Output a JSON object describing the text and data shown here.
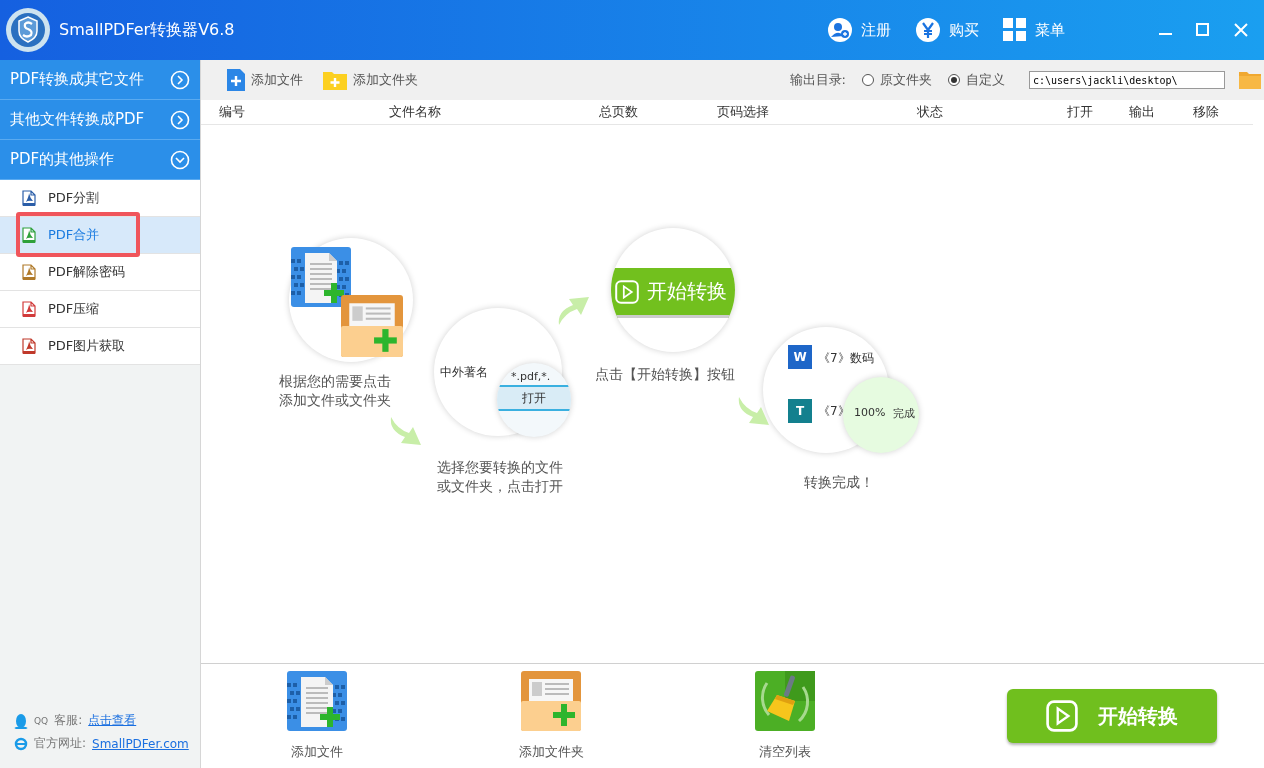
{
  "window": {
    "title": "SmallPDFer转换器V6.8",
    "actions": [
      {
        "kind": "register",
        "label": "注册"
      },
      {
        "kind": "buy",
        "label": "购买"
      },
      {
        "kind": "menu",
        "label": "菜单"
      }
    ]
  },
  "sidebar": {
    "sections": [
      {
        "label": "PDF转换成其它文件",
        "expanded": false
      },
      {
        "label": "其他文件转换成PDF",
        "expanded": false
      },
      {
        "label": "PDF的其他操作",
        "expanded": true,
        "items": [
          {
            "label": "PDF分割",
            "color": "#2b5ea8",
            "selected": false,
            "highlighted": false
          },
          {
            "label": "PDF合并",
            "color": "#2ea13a",
            "selected": true,
            "highlighted": true
          },
          {
            "label": "PDF解除密码",
            "color": "#b07a2a",
            "selected": false,
            "highlighted": false
          },
          {
            "label": "PDF压缩",
            "color": "#d23a3a",
            "selected": false,
            "highlighted": false
          },
          {
            "label": "PDF图片获取",
            "color": "#c0392b",
            "selected": false,
            "highlighted": false
          }
        ]
      }
    ],
    "footer": {
      "support_prefix": "QQ",
      "support_label": "客服:",
      "support_link": "点击查看",
      "site_label": "官方网址:",
      "site_link": "SmallPDFer.com"
    }
  },
  "toolbar": {
    "add_file": "添加文件",
    "add_folder": "添加文件夹",
    "output_label": "输出目录:",
    "output_options": [
      {
        "label": "原文件夹",
        "selected": false
      },
      {
        "label": "自定义",
        "selected": true
      }
    ],
    "output_path": "c:\\users\\jackli\\desktop\\"
  },
  "table": {
    "columns": [
      "编号",
      "文件名称",
      "总页数",
      "页码选择",
      "状态",
      "打开",
      "输出",
      "移除"
    ]
  },
  "guide": {
    "steps": [
      {
        "kind": "add",
        "caption": "根据您的需要点击添加文件或文件夹"
      },
      {
        "kind": "open",
        "caption": "选择您要转换的文件或文件夹，点击打开",
        "file_name": "中外著名",
        "filter": "*.pdf,*.",
        "button": "打开"
      },
      {
        "kind": "start",
        "caption": "点击【开始转换】按钮",
        "button": "开始转换"
      },
      {
        "kind": "done",
        "caption": "转换完成！",
        "icon_1": "W",
        "icon_2": "T",
        "row_1": "《7》数码",
        "row_2": "《7》",
        "percent": "100%",
        "status": "完成"
      }
    ]
  },
  "bottom": {
    "buttons": [
      {
        "kind": "add_file",
        "label": "添加文件"
      },
      {
        "kind": "add_folder",
        "label": "添加文件夹"
      },
      {
        "kind": "clear",
        "label": "清空列表"
      }
    ],
    "start": "开始转换"
  }
}
